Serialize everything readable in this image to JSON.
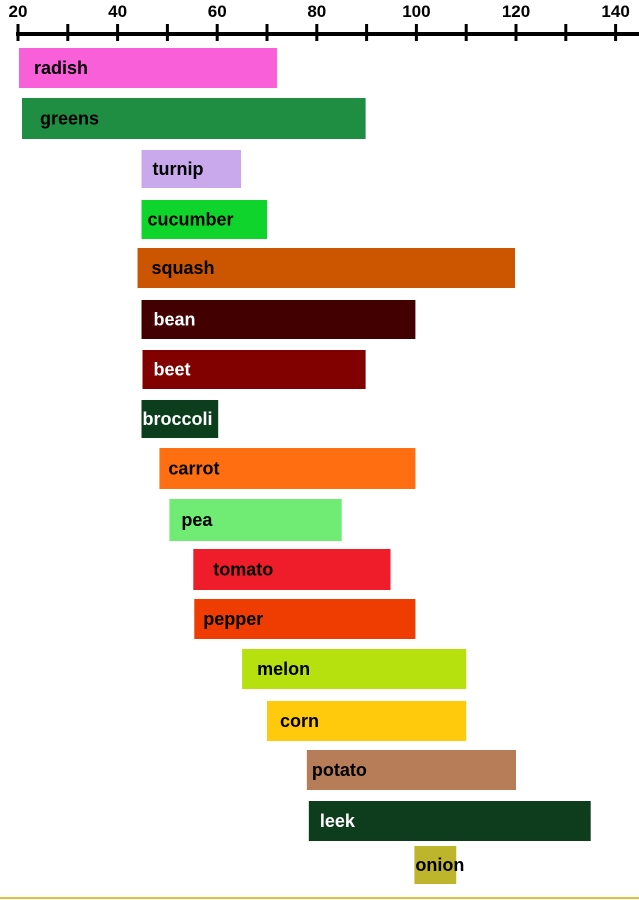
{
  "chart_data": {
    "type": "bar",
    "orientation": "horizontal-range",
    "x_axis": {
      "position": "top",
      "range": [
        20,
        145
      ],
      "major_ticks": [
        20,
        40,
        60,
        80,
        100,
        120,
        140
      ],
      "minor_ticks": [
        30,
        50,
        70,
        90,
        110,
        130
      ],
      "tick_labels": [
        "20",
        "40",
        "60",
        "80",
        "100",
        "120",
        "140"
      ]
    },
    "grid": false,
    "legend": "none",
    "bars": [
      {
        "label": "radish",
        "start": 20.2,
        "end": 72.0,
        "color": "#f95fd9",
        "label_color": "#000000"
      },
      {
        "label": "greens",
        "start": 20.8,
        "end": 89.8,
        "color": "#1f8e42",
        "label_color": "#000000"
      },
      {
        "label": "turnip",
        "start": 44.8,
        "end": 64.8,
        "color": "#c9a8ec",
        "label_color": "#000000"
      },
      {
        "label": "cucumber",
        "start": 44.8,
        "end": 70.0,
        "color": "#0ed42b",
        "label_color": "#000000"
      },
      {
        "label": "squash",
        "start": 44.0,
        "end": 119.8,
        "color": "#cc5500",
        "label_color": "#000000"
      },
      {
        "label": "bean",
        "start": 44.8,
        "end": 99.8,
        "color": "#420000",
        "label_color": "#ffffff"
      },
      {
        "label": "beet",
        "start": 45.0,
        "end": 89.8,
        "color": "#810000",
        "label_color": "#ffffff"
      },
      {
        "label": "broccoli",
        "start": 44.8,
        "end": 60.2,
        "color": "#0c3d1c",
        "label_color": "#ffffff"
      },
      {
        "label": "carrot",
        "start": 48.4,
        "end": 99.8,
        "color": "#ff6f12",
        "label_color": "#000000"
      },
      {
        "label": "pea",
        "start": 50.4,
        "end": 85.0,
        "color": "#70ec74",
        "label_color": "#000000"
      },
      {
        "label": "tomato",
        "start": 55.2,
        "end": 94.8,
        "color": "#ee1d29",
        "label_color": "#000000"
      },
      {
        "label": "pepper",
        "start": 55.4,
        "end": 99.8,
        "color": "#ef3c00",
        "label_color": "#000000"
      },
      {
        "label": "melon",
        "start": 65.0,
        "end": 110.0,
        "color": "#b6e00e",
        "label_color": "#000000"
      },
      {
        "label": "corn",
        "start": 70.0,
        "end": 110.0,
        "color": "#ffc90c",
        "label_color": "#000000"
      },
      {
        "label": "potato",
        "start": 78.0,
        "end": 120.0,
        "color": "#b77c58",
        "label_color": "#000000"
      },
      {
        "label": "leek",
        "start": 78.4,
        "end": 135.0,
        "color": "#0d3d1d",
        "label_color": "#ffffff"
      },
      {
        "label": "onion",
        "start": 99.6,
        "end": 108.0,
        "color": "#bdb52b",
        "label_color": "#000000"
      }
    ]
  }
}
